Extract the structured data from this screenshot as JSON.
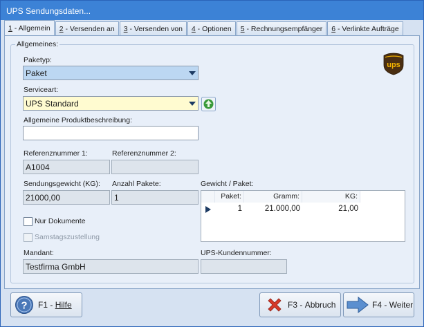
{
  "window": {
    "title": "UPS Sendungsdaten..."
  },
  "tabs": [
    {
      "key": "1",
      "label": " - Allgemein",
      "active": true
    },
    {
      "key": "2",
      "label": " - Versenden an"
    },
    {
      "key": "3",
      "label": " - Versenden von"
    },
    {
      "key": "4",
      "label": " - Optionen"
    },
    {
      "key": "5",
      "label": " - Rechnungsempfänger"
    },
    {
      "key": "6",
      "label": " - Verlinkte Aufträge"
    }
  ],
  "general": {
    "legend": "Allgemeines:",
    "logo_text": "ups",
    "pakettyp": {
      "label": "Paketyp:",
      "value": "Paket"
    },
    "serviceart": {
      "label": "Serviceart:",
      "value": "UPS Standard"
    },
    "beschreibung": {
      "label": "Allgemeine Produktbeschreibung:",
      "value": ""
    },
    "ref1": {
      "label": "Referenznummer 1:",
      "value": "A1004"
    },
    "ref2": {
      "label": "Referenznummer 2:",
      "value": ""
    },
    "gewicht": {
      "label": "Sendungsgewicht (KG):",
      "value": "21000,00"
    },
    "anzahl": {
      "label": "Anzahl Pakete:",
      "value": "1"
    },
    "gewicht_paket": {
      "label": "Gewicht / Paket:",
      "columns": [
        "Paket:",
        "Gramm:",
        "KG:"
      ],
      "rows": [
        {
          "paket": "1",
          "gramm": "21.000,00",
          "kg": "21,00"
        }
      ]
    },
    "nur_dokumente": {
      "label": "Nur Dokumente",
      "checked": false
    },
    "samstag": {
      "label": "Samstagszustellung",
      "checked": false,
      "disabled": true
    },
    "mandant": {
      "label": "Mandant:",
      "value": "Testfirma GmbH"
    },
    "ups_kunde": {
      "label": "UPS-Kundennummer:",
      "value": ""
    }
  },
  "buttons": {
    "help": {
      "key": "F1",
      "label": "Hilfe"
    },
    "cancel": {
      "key": "F3",
      "label": "Abbruch"
    },
    "next": {
      "key": "F4",
      "label": "Weiter"
    }
  },
  "colors": {
    "title_bar": "#3c82d6",
    "ups_brown": "#4a2e12",
    "ups_gold": "#f4b400"
  }
}
